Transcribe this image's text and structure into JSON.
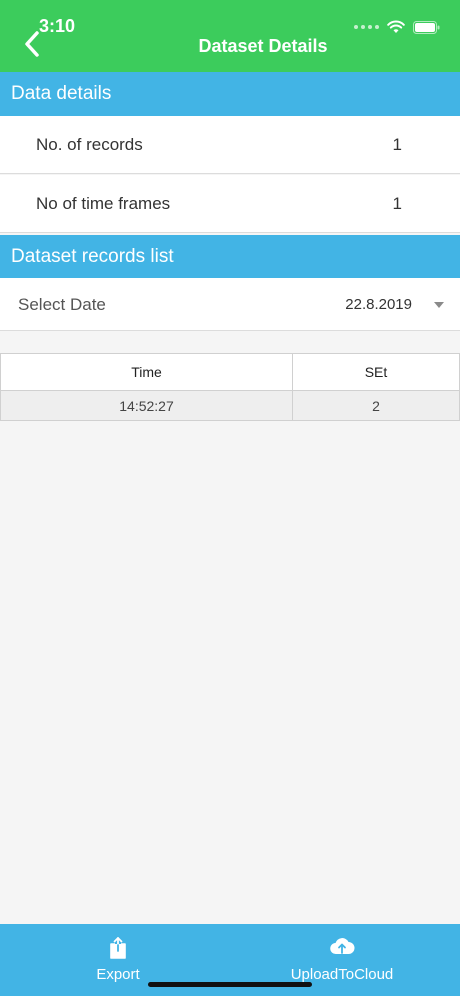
{
  "status_bar": {
    "time": "3:10"
  },
  "nav": {
    "title": "Dataset Details"
  },
  "data_details": {
    "header": "Data details",
    "rows": [
      {
        "label": "No. of records",
        "value": "1"
      },
      {
        "label": "No of time frames",
        "value": "1"
      }
    ]
  },
  "records_list": {
    "header": "Dataset records list",
    "select_date_label": "Select Date",
    "selected_date": "22.8.2019",
    "table": {
      "columns": [
        "Time",
        "SEt"
      ],
      "rows": [
        [
          "14:52:27",
          "2"
        ]
      ]
    }
  },
  "bottom_bar": {
    "export_label": "Export",
    "upload_label": "UploadToCloud"
  },
  "colors": {
    "status_bar": "#3ccc5c",
    "accent": "#42b4e5"
  },
  "icons": {
    "back": "chevron-left-icon",
    "wifi": "wifi-icon",
    "battery": "battery-icon",
    "export": "share-upload-icon",
    "upload": "cloud-upload-icon",
    "dropdown": "caret-down-icon"
  }
}
